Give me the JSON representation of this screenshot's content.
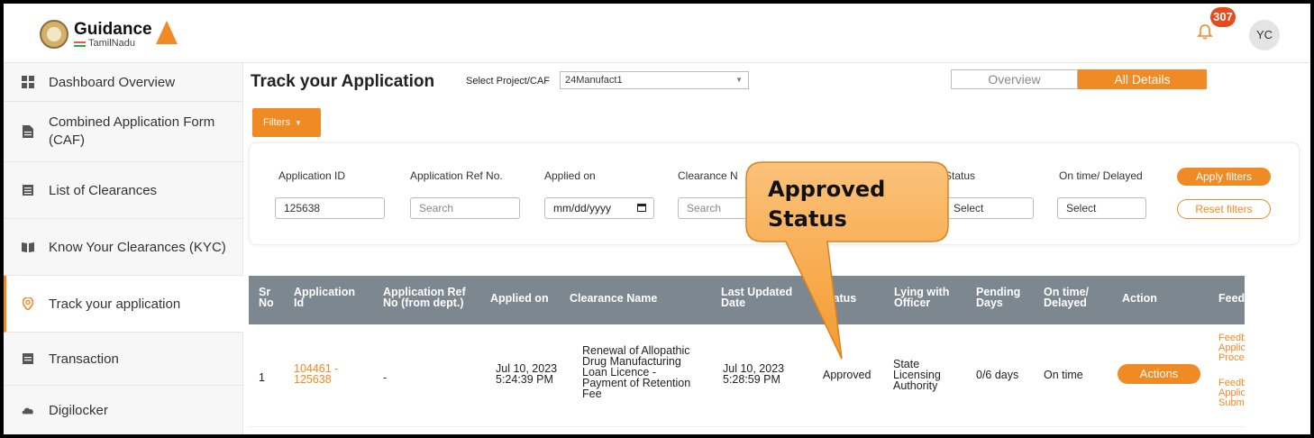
{
  "header": {
    "logo_main": "Guidance",
    "logo_sub": "TamilNadu",
    "notification_count": "307",
    "user_initials": "YC"
  },
  "sidebar": {
    "items": [
      {
        "label": "Dashboard Overview",
        "icon": "grid-icon"
      },
      {
        "label": "Combined Application Form (CAF)",
        "icon": "document-icon"
      },
      {
        "label": "List of Clearances",
        "icon": "list-icon"
      },
      {
        "label": "Know Your Clearances (KYC)",
        "icon": "book-icon"
      },
      {
        "label": "Track your application",
        "icon": "location-pin-icon",
        "active": true
      },
      {
        "label": "Transaction",
        "icon": "receipt-icon"
      },
      {
        "label": "Digilocker",
        "icon": "cloud-icon"
      }
    ]
  },
  "main": {
    "title": "Track your Application",
    "project_label": "Select Project/CAF",
    "project_value": "24Manufact1",
    "tabs": [
      {
        "label": "Overview",
        "active": false
      },
      {
        "label": "All Details",
        "active": true
      }
    ],
    "filters_button": "Filters"
  },
  "filters": {
    "application_id": {
      "label": "Application ID",
      "value": "125638"
    },
    "application_ref": {
      "label": "Application Ref No.",
      "placeholder": "Search"
    },
    "applied_on": {
      "label": "Applied on",
      "value": "mm/dd/yyyy"
    },
    "clearance_name": {
      "label": "Clearance N",
      "placeholder": "Search"
    },
    "status": {
      "label": "Status",
      "value": "Select"
    },
    "on_time": {
      "label": "On time/ Delayed",
      "value": "Select"
    },
    "apply_label": "Apply filters",
    "reset_label": "Reset filters"
  },
  "table": {
    "headers": {
      "sr": [
        "Sr",
        "No"
      ],
      "app_id": [
        "Application",
        "Id"
      ],
      "app_ref": [
        "Application Ref",
        "No (from dept.)"
      ],
      "applied_on": [
        "Applied on"
      ],
      "clearance": [
        "Clearance Name"
      ],
      "last_updated": [
        "Last Updated",
        "Date"
      ],
      "status": [
        "Status"
      ],
      "lying": [
        "Lying with",
        "Officer"
      ],
      "pending": [
        "Pending",
        "Days"
      ],
      "ontime": [
        "On time/",
        "Delayed"
      ],
      "action": [
        "Action"
      ],
      "feedback": [
        "Feedback"
      ]
    },
    "row": {
      "sr": "1",
      "app_id": [
        "104461 -",
        "125638"
      ],
      "app_ref": "-",
      "applied_on": [
        "Jul 10, 2023",
        "5:24:39 PM"
      ],
      "clearance": [
        "Renewal of Allopathic",
        "Drug Manufacturing",
        "Loan Licence -",
        "Payment of Retention",
        "Fee"
      ],
      "last_updated": [
        "Jul 10, 2023",
        "5:28:59 PM"
      ],
      "status": "Approved",
      "lying": [
        "State",
        "Licensing",
        "Authority"
      ],
      "pending": "0/6 days",
      "ontime": "On time",
      "action_label": "Actions",
      "feedback": [
        "Feedback on",
        "Application",
        "Process",
        "Feedback on",
        "Application",
        "Submission"
      ]
    }
  },
  "callout": {
    "line1": "Approved",
    "line2": "Status"
  },
  "colors": {
    "accent": "#f08a24",
    "table_header": "#7d8790",
    "badge": "#e8491d"
  }
}
